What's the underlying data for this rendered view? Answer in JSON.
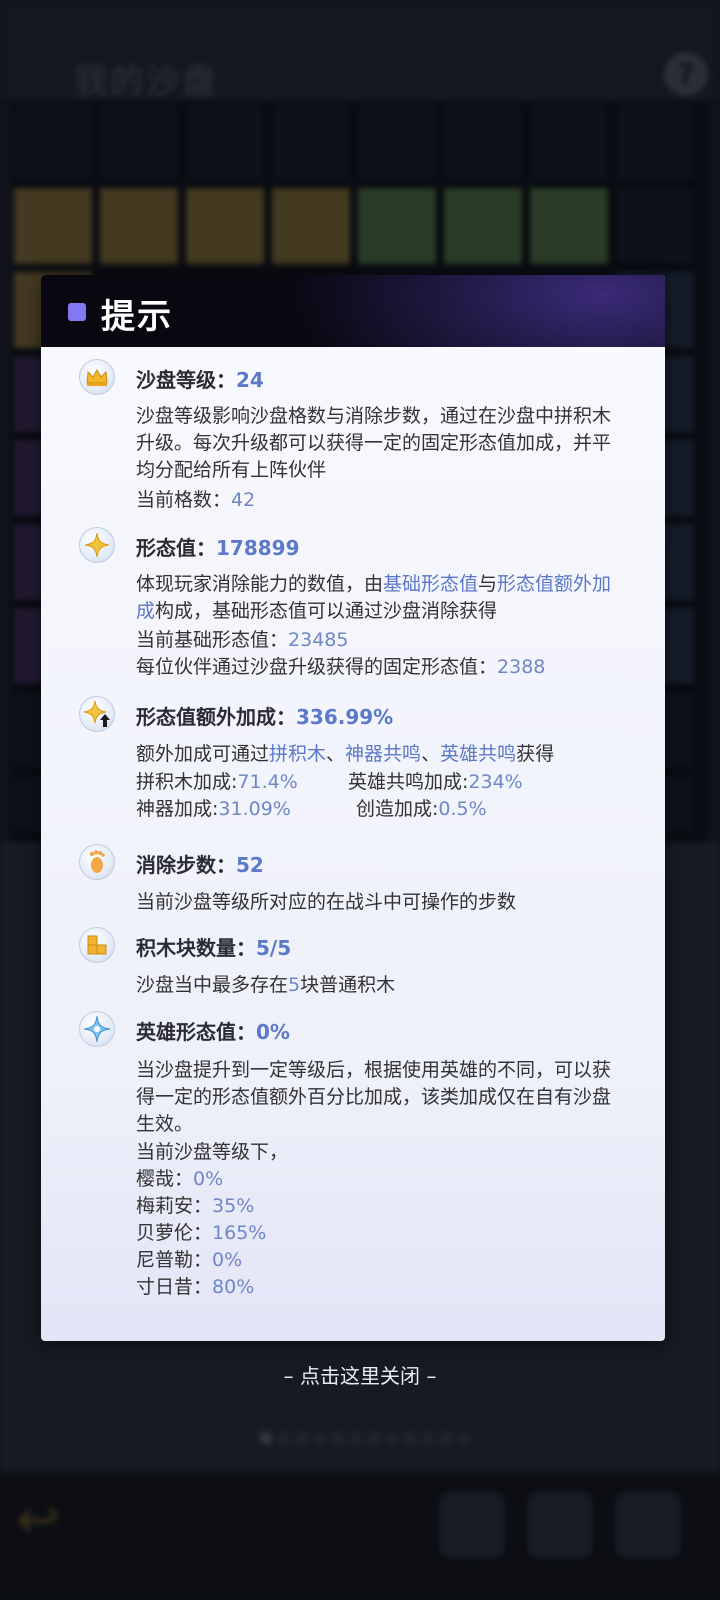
{
  "background": {
    "title": "我的沙盘",
    "help_glyph": "?"
  },
  "dialog": {
    "title": "提示",
    "sections": [
      {
        "title": "沙盘等级：",
        "value": "24",
        "icon": "crown-icon",
        "description": "沙盘等级影响沙盘格数与消除步数，通过在沙盘中拼积木升级。每次升级都可以获得一定的固定形态值加成，并平均分配给所有上阵伙伴",
        "stat_label": "当前格数：",
        "stat_value": "42"
      },
      {
        "title": "形态值：",
        "value": "178899",
        "icon": "sparkle-star-icon",
        "desc_part1": "体现玩家消除能力的数值，由",
        "desc_link1": "基础形态值",
        "desc_part2": "与",
        "desc_link2": "形态值额外加成",
        "desc_part3": "构成，基础形态值可以通过沙盘消除获得",
        "stat1_label": "当前基础形态值：",
        "stat1_value": "23485",
        "stat2_label": "每位伙伴通过沙盘升级获得的固定形态值：",
        "stat2_value": "2388"
      },
      {
        "title": "形态值额外加成：",
        "value": "336.99%",
        "icon": "star-up-arrow-icon",
        "desc_part1": "额外加成可通过",
        "link1": "拼积木",
        "sep1": "、",
        "link2": "神器共鸣",
        "sep2": "、",
        "link3": "英雄共鸣",
        "desc_part2": "获得",
        "bonuses": [
          {
            "label": "拼积木加成:",
            "value": "71.4%"
          },
          {
            "label": "英雄共鸣加成:",
            "value": "234%"
          },
          {
            "label": "神器加成:",
            "value": "31.09%"
          },
          {
            "label": "创造加成:",
            "value": "0.5%"
          }
        ]
      },
      {
        "title": "消除步数：",
        "value": "52",
        "icon": "footprint-icon",
        "description": "当前沙盘等级所对应的在战斗中可操作的步数"
      },
      {
        "title": "积木块数量：",
        "value": "5/5",
        "icon": "block-icon",
        "desc_part1": "沙盘当中最多存在",
        "desc_num": "5",
        "desc_part2": "块普通积木"
      },
      {
        "title": "英雄形态值：",
        "value": "0%",
        "icon": "blue-star-icon",
        "description": "当沙盘提升到一定等级后，根据使用英雄的不同，可以获得一定的形态值额外百分比加成，该类加成仅在自有沙盘生效。",
        "list_header": "当前沙盘等级下，",
        "heroes": [
          {
            "name": "樱哉：",
            "value": "0%"
          },
          {
            "name": "梅莉安：",
            "value": "35%"
          },
          {
            "name": "贝萝伦：",
            "value": "165%"
          },
          {
            "name": "尼普勒：",
            "value": "0%"
          },
          {
            "name": "寸日昔：",
            "value": "80%"
          }
        ]
      }
    ]
  },
  "close_hint": "– 点击这里关闭 –",
  "colors": {
    "accent": "#5b79c8",
    "header_bg": "#09070f",
    "header_square": "#8478f2"
  }
}
